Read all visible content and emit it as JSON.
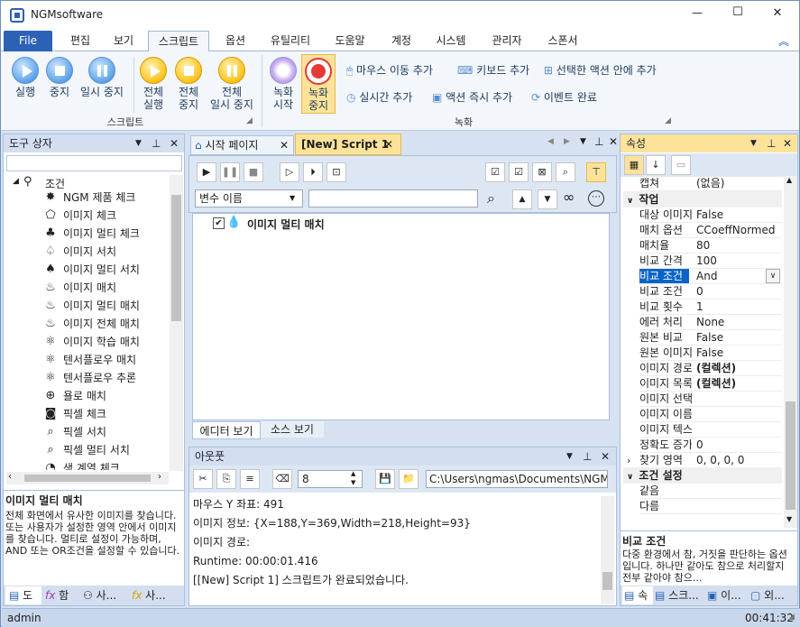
{
  "app": {
    "title": "NGMsoftware"
  },
  "window_controls": {
    "minimize": "—",
    "maximize": "☐",
    "close": "✕"
  },
  "menu_tabs": [
    "File",
    "편집",
    "보기",
    "스크립트",
    "옵션",
    "유틸리티",
    "도움말",
    "계정",
    "시스템",
    "관리자",
    "스폰서"
  ],
  "ribbon": {
    "script_buttons": [
      {
        "label": "실행"
      },
      {
        "label": "중지"
      },
      {
        "label": "일시 중지"
      },
      {
        "label": "전체\n실행"
      },
      {
        "label": "전체\n중지"
      },
      {
        "label": "전체\n일시 중지"
      }
    ],
    "script_group": "스크립트",
    "record_buttons": [
      {
        "label": "녹화\n시작"
      },
      {
        "label": "녹화\n중지"
      }
    ],
    "record_actions": [
      "마우스 이동 추가",
      "키보드 추가",
      "선택한 액션 안에 추가",
      "실시간 추가",
      "액션 즉시 추가",
      "이벤트 완료"
    ],
    "record_group": "녹화"
  },
  "toolbox": {
    "title": "도구 상자",
    "root": "조건",
    "items": [
      "NGM 제품 체크",
      "이미지 체크",
      "이미지 멀티 체크",
      "이미지 서치",
      "이미지 멀티 서치",
      "이미지 매치",
      "이미지 멀티 매치",
      "이미지 전체 매치",
      "이미지 학습 매치",
      "텐서플로우 매치",
      "텐서플로우 추론",
      "욜로 매치",
      "픽셀 체크",
      "픽셀 서치",
      "픽셀 멀티 서치",
      "색 계열 체크"
    ],
    "desc_title": "이미지 멀티 매치",
    "desc_text": "전체 화면에서 유사한 이미지를 찾습니다. 또는 사용자가 설정한 영역 안에서 이미지를 찾습니다. 멀티로 설정이 가능하며, AND 또는 OR조건을 설정할 수 있습니다.",
    "bottom_tabs": [
      "도",
      "함",
      "사...",
      "사..."
    ]
  },
  "doc_tabs": {
    "start": "시작 페이지",
    "script": "[New] Script 1"
  },
  "editor": {
    "var_select": "변수 이름",
    "search_value": "",
    "node_label": "이미지 멀티 매치",
    "bottom_tabs": [
      "에디터 보기",
      "소스 보기"
    ]
  },
  "output": {
    "title": "아웃풋",
    "number": "8",
    "path": "C:\\Users\\ngmas\\Documents\\NGM6\\",
    "lines": [
      "마우스 Y 좌표: 491",
      "이미지 정보: {X=188,Y=369,Width=218,Height=93}",
      "이미지 경로:",
      "Runtime: 00:00:01.416",
      "[[New] Script 1] 스크립트가 완료되었습니다."
    ]
  },
  "properties": {
    "title": "속성",
    "top_row": {
      "name": "캡쳐",
      "value": "(없음)"
    },
    "category1": "작업",
    "rows": [
      {
        "name": "대상 이미지",
        "value": "False"
      },
      {
        "name": "매치 옵션",
        "value": "CCoeffNormed"
      },
      {
        "name": "매치율",
        "value": "80"
      },
      {
        "name": "비교 간격",
        "value": "100"
      },
      {
        "name": "비교 조건",
        "value": "And",
        "selected": true
      },
      {
        "name": "비교 조건",
        "value": "0"
      },
      {
        "name": "비교 횟수",
        "value": "1"
      },
      {
        "name": "에러 처리",
        "value": "None"
      },
      {
        "name": "원본 비교",
        "value": "False"
      },
      {
        "name": "원본 이미지",
        "value": "False"
      },
      {
        "name": "이미지 경로",
        "value": "(컬렉션)",
        "bold": true
      },
      {
        "name": "이미지 목록",
        "value": "(컬렉션)",
        "bold": true
      },
      {
        "name": "이미지 선택",
        "value": ""
      },
      {
        "name": "이미지 이름",
        "value": ""
      },
      {
        "name": "이미지 텍스트",
        "value": ""
      },
      {
        "name": "정확도 증가",
        "value": "0"
      },
      {
        "name": "찾기 영역",
        "value": "0, 0, 0, 0",
        "expandable": true
      }
    ],
    "category2": "조건 설정",
    "rows2": [
      {
        "name": "같음",
        "value": ""
      },
      {
        "name": "다름",
        "value": ""
      }
    ],
    "desc_title": "비교 조건",
    "desc_text": "다중 환경에서 참, 거짓을 판단하는 옵션입니다. 하나만 같아도 참으로 처리할지 전부 같아야 참으...",
    "bottom_tabs": [
      "속",
      "스크...",
      "이...",
      "외..."
    ]
  },
  "status": {
    "user": "admin",
    "time": "00:41:32"
  },
  "colors": {
    "accent": "#2b62b5",
    "record": "#e53935",
    "selected": "#0a64c8"
  }
}
